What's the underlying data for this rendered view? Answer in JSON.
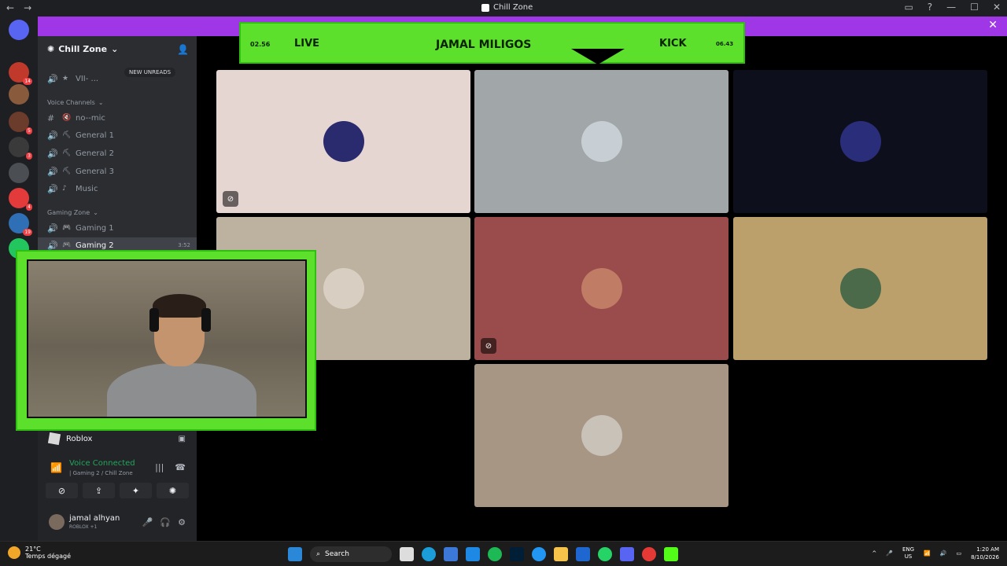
{
  "window": {
    "title": "Chill Zone",
    "nav_back": "←",
    "nav_forward": "→",
    "controls": [
      "▭",
      "?",
      "—",
      "☐",
      "✕"
    ]
  },
  "banner": {
    "close": "✕",
    "color": "#a037e6"
  },
  "servers": [
    {
      "badge": "14",
      "color": "#c0392b"
    },
    {
      "badge": "",
      "color": "#8a5a3c"
    },
    {
      "badge": "5",
      "color": "#6b3b2b"
    },
    {
      "badge": "3",
      "color": "#3a3a3a"
    },
    {
      "badge": "",
      "color": "#4b4f53"
    },
    {
      "badge": "4",
      "color": "#e33b3b"
    },
    {
      "badge": "19",
      "color": "#2f6fb5"
    },
    {
      "badge": "",
      "color": "#22c55e"
    }
  ],
  "sidebar": {
    "guild_name": "Chill Zone",
    "new_unreads": "NEW UNREADS",
    "top_channel": "VII- ...",
    "categories": [
      {
        "name": "Voice Channels",
        "channels": [
          {
            "name": "no--mic",
            "icon": "#"
          },
          {
            "name": "General 1",
            "icon": "🔊"
          },
          {
            "name": "General 2",
            "icon": "🔊"
          },
          {
            "name": "General 3",
            "icon": "🔊"
          },
          {
            "name": "Music",
            "icon": "🔊"
          }
        ]
      },
      {
        "name": "Gaming Zone",
        "channels": [
          {
            "name": "Gaming 1",
            "icon": "🔊"
          },
          {
            "name": "Gaming 2",
            "icon": "🔊",
            "time": "3:52"
          }
        ]
      }
    ]
  },
  "voicebar": {
    "game": "Roblox",
    "status": "Voice Connected",
    "channel": "| Gaming 2 / Chill Zone",
    "user_name": "jamal alhyan",
    "user_status": "ROBLOX +1"
  },
  "overlay": {
    "left_time": "02.56",
    "live": "LIVE",
    "name": "JAMAL MILIGOS",
    "kick": "KICK",
    "right_time": "06.43"
  },
  "tiles": [
    {
      "bg": "#e5d6d2",
      "avatar": "#2a2a6e",
      "mute": true
    },
    {
      "bg": "#a1a6a8",
      "avatar": "#c8cfd4",
      "mute": false
    },
    {
      "bg": "#0e0f1c",
      "avatar": "#2a2e7a",
      "mute": false
    },
    {
      "bg": "#bdb2a0",
      "avatar": "#d8cfc2",
      "mute": false
    },
    {
      "bg": "#9a4c4c",
      "avatar": "#c07c64",
      "mute": true
    },
    {
      "bg": "#bba06b",
      "avatar": "#4a6a4a",
      "mute": false
    },
    {
      "bg": "#a89684",
      "avatar": "#c9c2b9",
      "mute": false
    }
  ],
  "taskbar": {
    "temp": "21°C",
    "weather": "Temps dégagé",
    "search": "Search",
    "lang_1": "ENG",
    "lang_2": "US",
    "time": "1:20 AM",
    "date": "8/10/2026"
  }
}
